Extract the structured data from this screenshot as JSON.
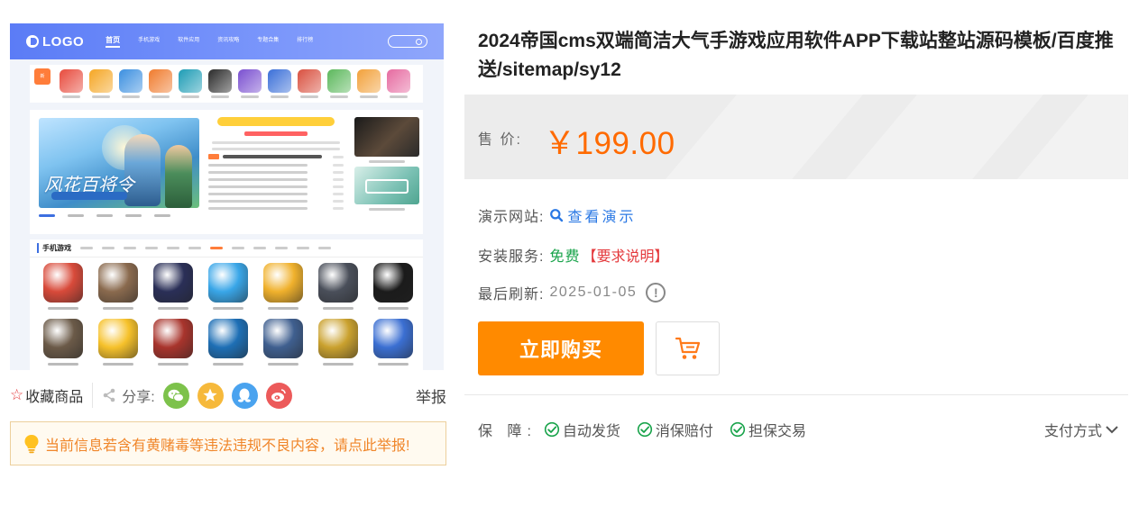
{
  "preview": {
    "logo": "LOGO",
    "nav_items": [
      "首页",
      "手机游戏",
      "软件应用",
      "资讯攻略",
      "专题合集",
      "排行榜"
    ],
    "banner_title": "风花百将令",
    "section_title": "手机游戏",
    "strip_colors": [
      "#e84a3c",
      "#f5a623",
      "#3b8fe0",
      "#f07b2d",
      "#1d9cb5",
      "#2a2a2a",
      "#7a4fd0",
      "#3a6fd8",
      "#d9503f",
      "#5cb85c",
      "#f2a13a",
      "#e66aa0"
    ],
    "grid_colors": [
      "#d84a3a",
      "#8a6a4e",
      "#2a2f57",
      "#39a6e8",
      "#f0b12c",
      "#4a4f5a",
      "#1b1b1b",
      "#6b5a48",
      "#f6c12a",
      "#a8342c",
      "#1e6fb5",
      "#3f5f8f",
      "#caa12e",
      "#3b6fd2"
    ]
  },
  "actions": {
    "favorite": "收藏商品",
    "share_label": "分享:",
    "report": "举报",
    "share_targets": [
      {
        "name": "wechat-icon",
        "color": "#7dc24b"
      },
      {
        "name": "qzone-icon",
        "color": "#f6b93b"
      },
      {
        "name": "qq-icon",
        "color": "#4aa3ef"
      },
      {
        "name": "weibo-icon",
        "color": "#ec5a5a"
      }
    ]
  },
  "notice": "当前信息若含有黄赌毒等违法违规不良内容，请点此举报!",
  "product": {
    "title": "2024帝国cms双端简洁大气手游戏应用软件APP下载站整站源码模板/百度推送/sitemap/sy12",
    "price_label": "售 价:",
    "price": "￥199.00",
    "demo_label": "演示网站:",
    "demo_link": "查看演示",
    "install_label": "安装服务:",
    "install_value": "免费",
    "install_note": "【要求说明】",
    "refresh_label": "最后刷新:",
    "refresh_date": "2025-01-05",
    "buy_button": "立即购买",
    "guarantee_label": "保 障:",
    "guarantees": [
      "自动发货",
      "消保赔付",
      "担保交易"
    ],
    "payment": "支付方式"
  },
  "colors": {
    "accent": "#ff8a00",
    "price": "#ff6a00",
    "link": "#2a78e4",
    "free": "#18a34a",
    "red": "#e4393c"
  }
}
